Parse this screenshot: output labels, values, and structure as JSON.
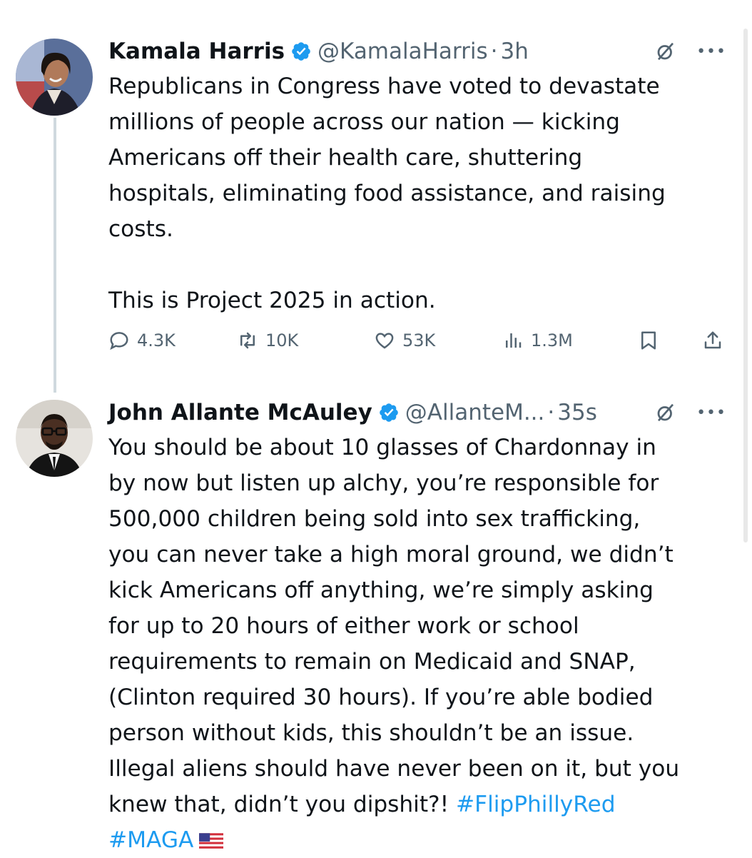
{
  "tweets": [
    {
      "name": "Kamala Harris",
      "handle": "@KamalaHarris",
      "separator": "·",
      "time": "3h",
      "body": "Republicans in Congress have voted to devastate\nmillions of people across our nation — kicking\nAmericans off their health care, shuttering\nhospitals, eliminating food assistance, and raising\ncosts.\n\nThis is Project 2025 in action.",
      "stats": {
        "replies": "4.3K",
        "reposts": "10K",
        "likes": "53K",
        "views": "1.3M"
      }
    },
    {
      "name": "John Allante McAuley",
      "handle": "@AllanteM...",
      "separator": "·",
      "time": "35s",
      "body": "You should be about 10 glasses of Chardonnay in\nby now but listen up alchy, you’re responsible for\n500,000 children being sold into sex trafficking,\nyou can never take a high moral ground, we didn’t\nkick Americans off anything, we’re simply asking\nfor up to 20 hours of either work or school\nrequirements to remain on Medicaid and SNAP,\n(Clinton required 30 hours). If you’re able bodied\nperson without kids, this shouldn’t be an issue.\nIllegal aliens should have never been on it, but you\nknew that, didn’t you dipshit?! ",
      "hashtag1": "#FlipPhillyRed",
      "hashtag2": "#MAGA"
    }
  ],
  "more_label": "•••",
  "colors": {
    "accent": "#1d9bf0",
    "secondary_text": "#536471",
    "thread_line": "#cfd9de"
  }
}
